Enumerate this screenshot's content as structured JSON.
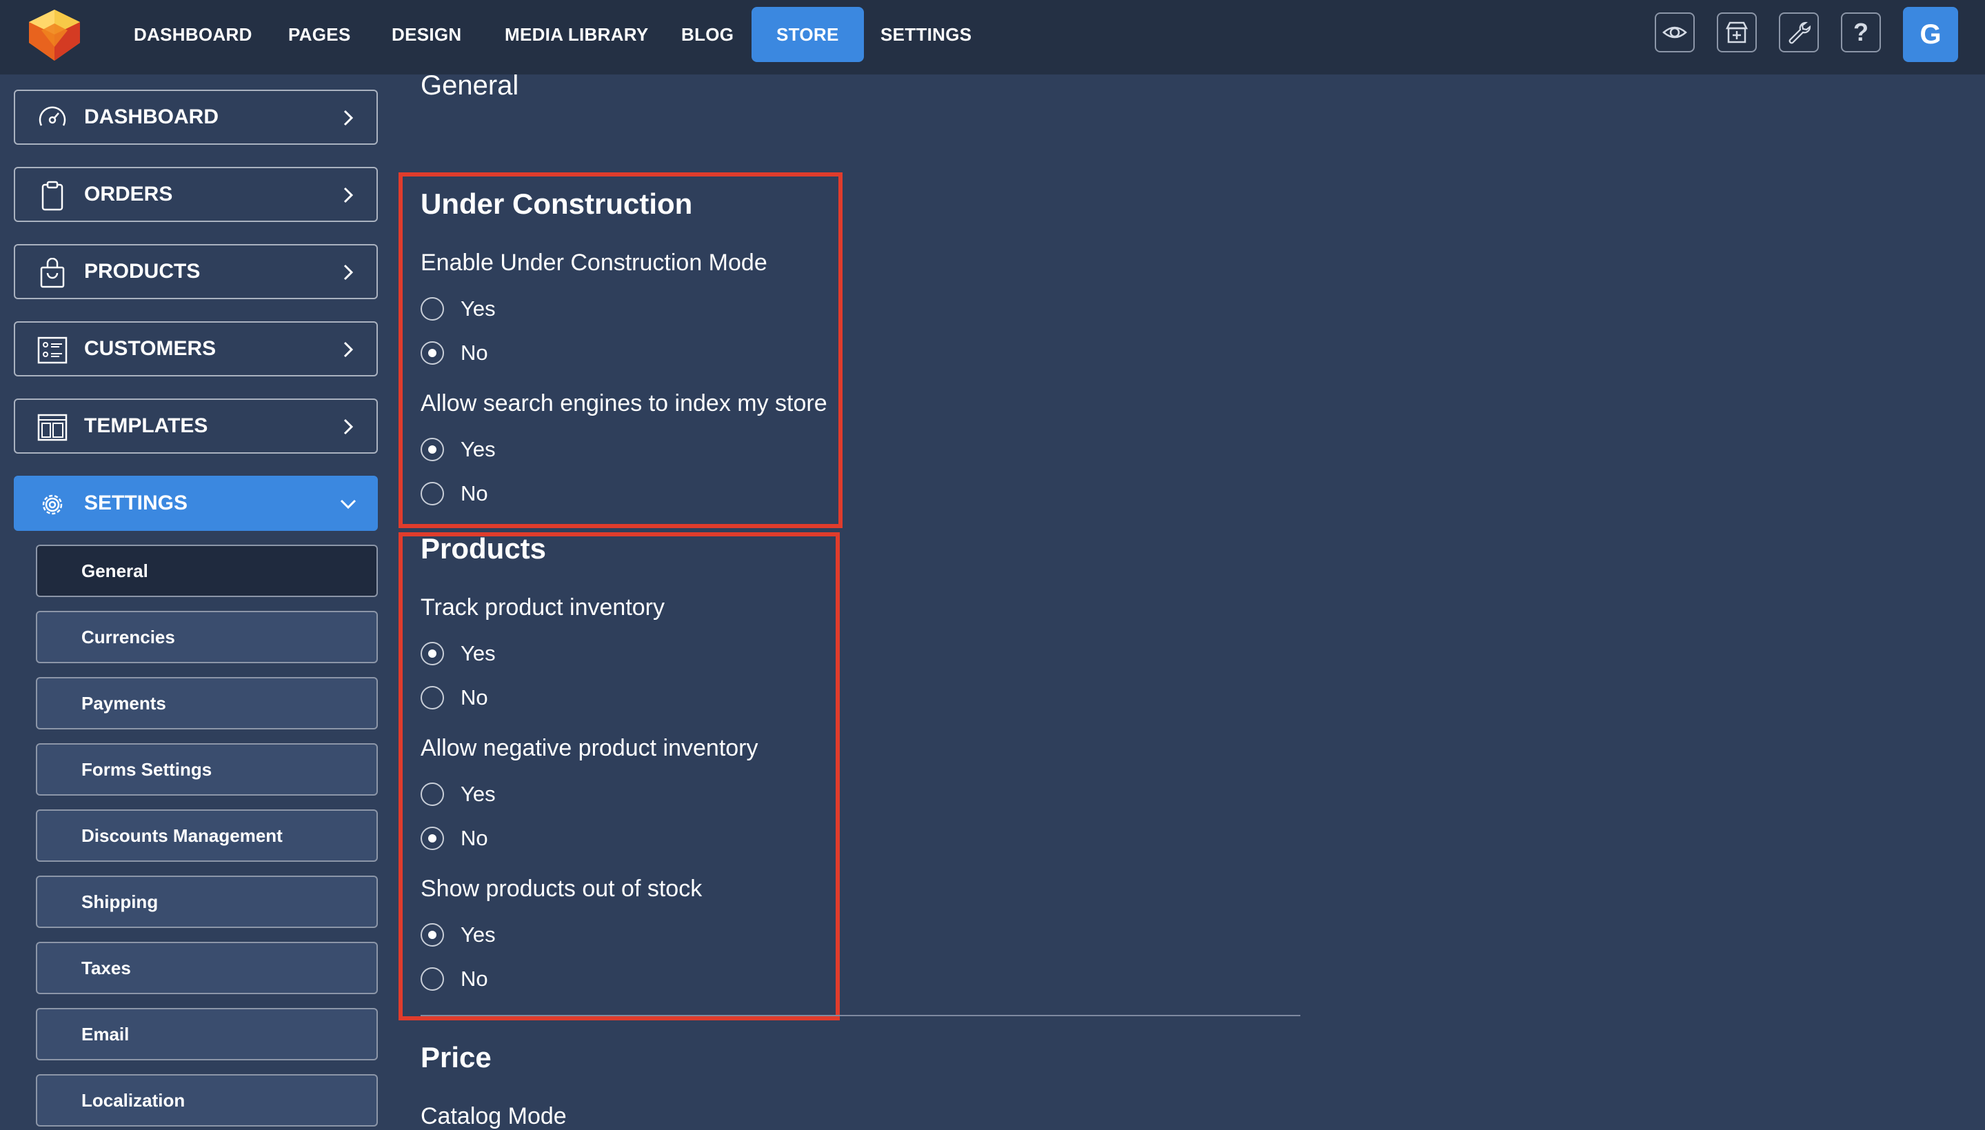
{
  "topnav": {
    "items": [
      "DASHBOARD",
      "PAGES",
      "DESIGN",
      "MEDIA LIBRARY",
      "BLOG",
      "STORE",
      "SETTINGS"
    ],
    "active": "STORE",
    "tools": [
      "eye-icon",
      "store-add-icon",
      "wrench-icon",
      "help-icon"
    ],
    "avatar_letter": "G"
  },
  "sidebar": {
    "items": [
      {
        "label": "DASHBOARD",
        "icon": "gauge-icon"
      },
      {
        "label": "ORDERS",
        "icon": "clipboard-icon"
      },
      {
        "label": "PRODUCTS",
        "icon": "shopping-bag-icon"
      },
      {
        "label": "CUSTOMERS",
        "icon": "contact-card-icon"
      },
      {
        "label": "TEMPLATES",
        "icon": "layout-icon"
      },
      {
        "label": "SETTINGS",
        "icon": "gear-icon",
        "expanded": true
      }
    ],
    "subitems": [
      "General",
      "Currencies",
      "Payments",
      "Forms Settings",
      "Discounts Management",
      "Shipping",
      "Taxes",
      "Email",
      "Localization"
    ],
    "active_subitem": "General"
  },
  "main": {
    "heading": "General",
    "under_construction": {
      "title": "Under Construction",
      "q1": {
        "label": "Enable Under Construction Mode",
        "options": [
          "Yes",
          "No"
        ],
        "selected": "No"
      },
      "q2": {
        "label": "Allow search engines to index my store",
        "options": [
          "Yes",
          "No"
        ],
        "selected": "Yes"
      }
    },
    "products": {
      "title": "Products",
      "q1": {
        "label": "Track product inventory",
        "options": [
          "Yes",
          "No"
        ],
        "selected": "Yes"
      },
      "q2": {
        "label": "Allow negative product inventory",
        "options": [
          "Yes",
          "No"
        ],
        "selected": "No"
      },
      "q3": {
        "label": "Show products out of stock",
        "options": [
          "Yes",
          "No"
        ],
        "selected": "Yes"
      }
    },
    "price": {
      "title": "Price",
      "catalog_mode_label": "Catalog Mode"
    }
  },
  "colors": {
    "accent": "#3b88e0",
    "highlight": "#e03c2c",
    "background": "#2f3f5b",
    "topbar": "#243044"
  }
}
